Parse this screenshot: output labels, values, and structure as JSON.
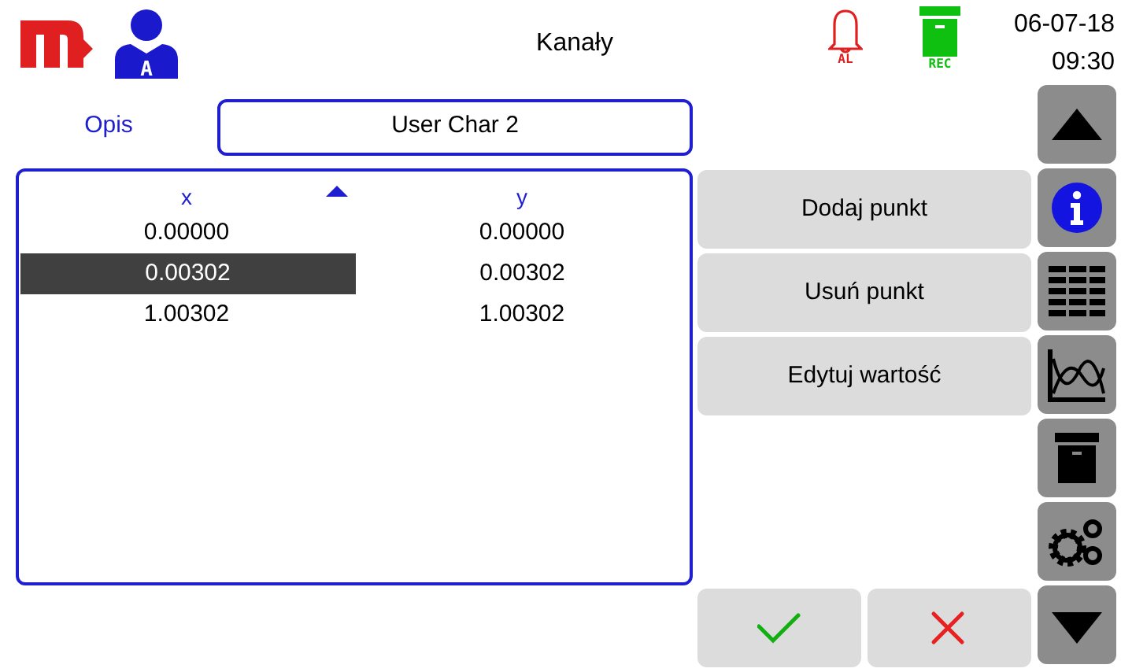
{
  "header": {
    "title": "Kanały",
    "user_badge": "A",
    "alarm_label": "AL",
    "rec_label": "REC",
    "date": "06-07-18",
    "time": "09:30"
  },
  "description": {
    "label": "Opis",
    "value": "User Char 2"
  },
  "table": {
    "columns": [
      {
        "label": "x",
        "sorted": true
      },
      {
        "label": "y",
        "sorted": false
      }
    ],
    "rows": [
      {
        "cells": [
          "0.00000",
          "0.00000"
        ],
        "selected": false
      },
      {
        "cells": [
          "0.00302",
          "0.00302"
        ],
        "selected": true
      },
      {
        "cells": [
          "1.00302",
          "1.00302"
        ],
        "selected": false
      }
    ]
  },
  "actions": [
    "Dodaj punkt",
    "Usuń punkt",
    "Edytuj wartość"
  ],
  "dialog_buttons": [
    {
      "kind": "confirm"
    },
    {
      "kind": "cancel"
    }
  ],
  "sidebar": [
    {
      "kind": "up"
    },
    {
      "kind": "info"
    },
    {
      "kind": "table"
    },
    {
      "kind": "chart"
    },
    {
      "kind": "archive"
    },
    {
      "kind": "settings"
    },
    {
      "kind": "down"
    }
  ]
}
